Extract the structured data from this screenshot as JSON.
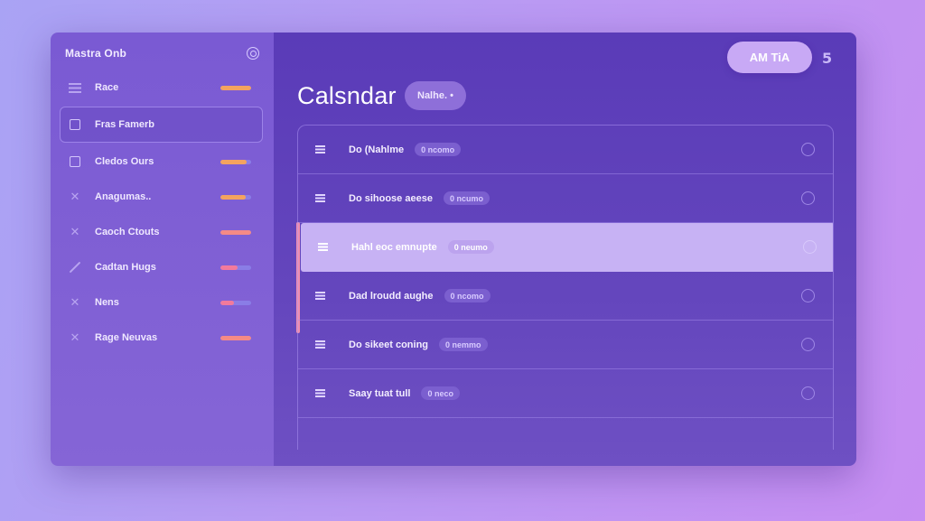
{
  "colors": {
    "accent_pink": "#f08fb0",
    "accent_orange": "#f4a35f",
    "accent_salmon": "#f58a86",
    "bar_track": "#8a7de6",
    "main_bg": "#5a3bb8",
    "sidebar_bg": "#7a5ad3",
    "selected_row": "#c7b2f4"
  },
  "sidebar": {
    "title": "Mastra Onb",
    "settings_icon": "gear-icon",
    "items": [
      {
        "label": "Race",
        "icon": "list-icon",
        "glyph": "",
        "progress": 1.0,
        "bar_color": "#f4a35f",
        "active": false
      },
      {
        "label": "Fras Famerb",
        "icon": "calendar-square-icon",
        "glyph": "",
        "progress": 0,
        "bar_color": "",
        "active": true
      },
      {
        "label": "Cledos Ours",
        "icon": "square-icon",
        "glyph": "",
        "progress": 0.85,
        "bar_color": "#f4a35f",
        "active": false
      },
      {
        "label": "Anagumas..",
        "icon": "agent-icon",
        "glyph": "✕",
        "progress": 0.82,
        "bar_color": "#f4a35f",
        "active": false
      },
      {
        "label": "Caoch Ctouts",
        "icon": "agent-icon",
        "glyph": "✕",
        "progress": 1.0,
        "bar_color": "#f58a86",
        "active": false
      },
      {
        "label": "Cadtan Hugs",
        "icon": "pen-icon",
        "glyph": "",
        "progress": 0.55,
        "bar_color": "#f27a9c",
        "active": false
      },
      {
        "label": "Nens",
        "icon": "agent-icon",
        "glyph": "✕",
        "progress": 0.45,
        "bar_color": "#f27a9c",
        "active": false
      },
      {
        "label": "Rage Neuvas",
        "icon": "agent-icon",
        "glyph": "✕",
        "progress": 1.0,
        "bar_color": "#f58a86",
        "active": false
      }
    ]
  },
  "header": {
    "action_button": "AM TiA",
    "extra_icon": "5"
  },
  "main": {
    "title": "Calsndar",
    "title_chip": "Nalhe. •",
    "rows": [
      {
        "title": "Do (Nahlme",
        "tag": "0 ncomo",
        "selected": false
      },
      {
        "title": "Do sihoose aeese",
        "tag": "0 ncumo",
        "selected": false
      },
      {
        "title": "Hahl eoc emnupte",
        "tag": "0 neumo",
        "selected": true
      },
      {
        "title": "Dad lroudd aughe",
        "tag": "0 ncomo",
        "selected": false
      },
      {
        "title": "Do sikeet coning",
        "tag": "0 nemmo",
        "selected": false
      },
      {
        "title": "Saay tuat tull",
        "tag": "0 neco",
        "selected": false
      }
    ]
  }
}
